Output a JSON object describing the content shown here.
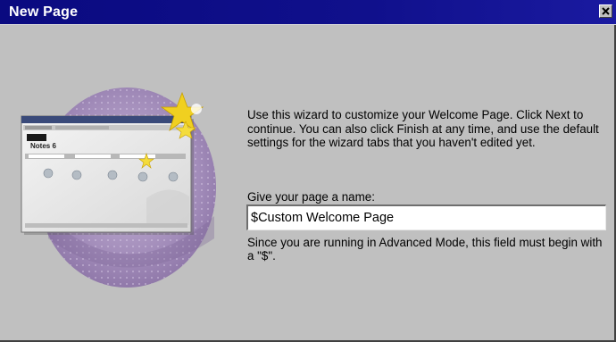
{
  "window": {
    "title": "New Page",
    "close_icon": "close-icon"
  },
  "illustration": {
    "icon": "notes-welcome-page-screenshot",
    "screen_title": "Notes 6",
    "colors": {
      "oval": "#a08ab8",
      "star": "#f0d020"
    }
  },
  "wizard": {
    "instructions": "Use this wizard to customize your Welcome Page.  Click Next to continue.  You can also click Finish at any time, and use the default settings for the wizard tabs that you haven't edited yet.",
    "name_label": "Give your page a name:",
    "name_value": "$Custom Welcome Page",
    "advanced_note": "Since you are running in Advanced Mode, this field must begin with a \"$\"."
  },
  "colors": {
    "titlebar": "#0a0a80",
    "background": "#c0c0c0"
  }
}
